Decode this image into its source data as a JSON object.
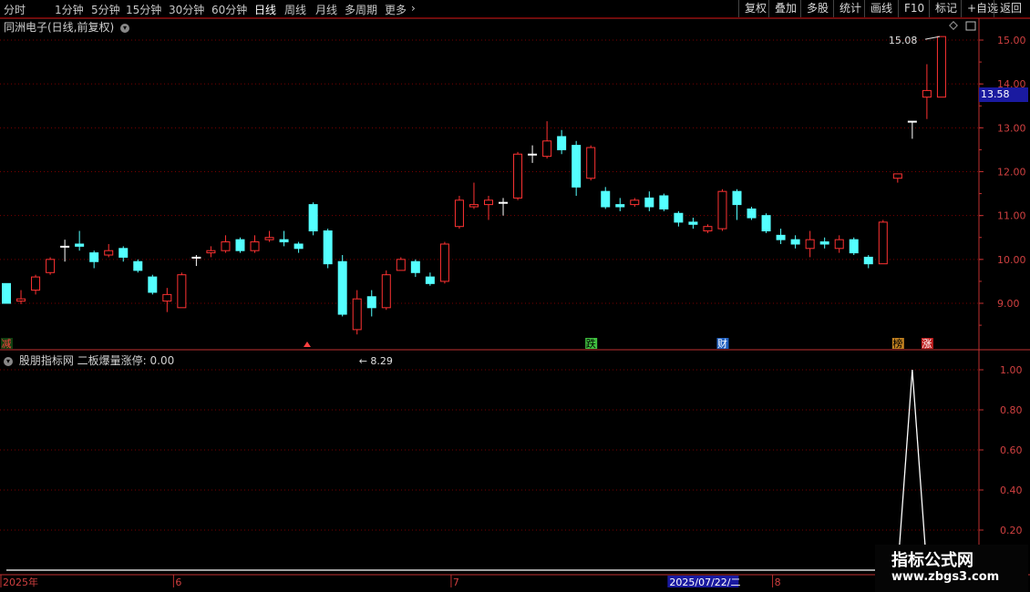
{
  "toolbar": {
    "periods": [
      "分时",
      "1分钟",
      "5分钟",
      "15分钟",
      "30分钟",
      "60分钟",
      "日线",
      "周线",
      "月线",
      "多周期",
      "更多"
    ],
    "active_period": "日线",
    "right_buttons": [
      "复权",
      "叠加",
      "多股",
      "统计",
      "画线",
      "F10",
      "标记",
      "+自选",
      "返回"
    ]
  },
  "upper": {
    "title": "同洲电子(日线,前复权)",
    "price_tag": "13.58",
    "high_label": "15.08",
    "low_label": "8.29",
    "markers": [
      {
        "text": "减",
        "color": "#ff4040",
        "bg": "#104010",
        "idx": 0
      },
      {
        "text": "跌",
        "color": "#000000",
        "bg": "#40c040",
        "idx": 40
      },
      {
        "text": "财",
        "color": "#ffffff",
        "bg": "#2060c0",
        "idx": 49
      },
      {
        "text": "榜",
        "color": "#000000",
        "bg": "#c08020",
        "idx": 61
      },
      {
        "text": "涨",
        "color": "#ffffff",
        "bg": "#c02020",
        "idx": 63
      }
    ]
  },
  "lower": {
    "title": "股朋指标网 二板爆量涨停: 0.00"
  },
  "logo": {
    "line1": "指标公式网",
    "line2": "www.zbgs3.com"
  },
  "xaxis": {
    "labels": [
      {
        "text": "2025年",
        "idx": 0
      },
      {
        "text": "6",
        "idx": 12
      },
      {
        "text": "7",
        "idx": 31
      },
      {
        "text": "8",
        "idx": 53
      }
    ],
    "cursor_date": "2025/07/22/二",
    "cursor_idx": 46
  },
  "chart_data": {
    "type": "candlestick",
    "price_axis": {
      "ticks": [
        9.0,
        10.0,
        11.0,
        12.0,
        13.0,
        14.0,
        15.0
      ],
      "ylim": [
        8.0,
        15.5
      ]
    },
    "indicator_axis": {
      "ticks": [
        0.2,
        0.4,
        0.6,
        0.8,
        1.0
      ],
      "ylim": [
        0,
        1.1
      ]
    },
    "candles": [
      [
        9.45,
        9.0,
        9.45,
        9.0
      ],
      [
        9.05,
        9.1,
        9.3,
        8.98
      ],
      [
        9.3,
        9.6,
        9.65,
        9.2
      ],
      [
        9.7,
        10.0,
        10.05,
        9.65
      ],
      [
        10.3,
        10.3,
        10.45,
        9.95
      ],
      [
        10.35,
        10.3,
        10.65,
        10.2
      ],
      [
        10.15,
        9.95,
        10.2,
        9.8
      ],
      [
        10.1,
        10.2,
        10.35,
        10.05
      ],
      [
        10.25,
        10.05,
        10.3,
        9.95
      ],
      [
        9.95,
        9.75,
        10.0,
        9.7
      ],
      [
        9.6,
        9.25,
        9.65,
        9.2
      ],
      [
        9.05,
        9.2,
        9.35,
        8.8
      ],
      [
        8.9,
        9.65,
        9.7,
        8.9
      ],
      [
        10.05,
        10.05,
        10.1,
        9.85
      ],
      [
        10.15,
        10.2,
        10.3,
        10.05
      ],
      [
        10.2,
        10.4,
        10.55,
        10.15
      ],
      [
        10.45,
        10.2,
        10.5,
        10.15
      ],
      [
        10.2,
        10.4,
        10.55,
        10.15
      ],
      [
        10.45,
        10.5,
        10.65,
        10.4
      ],
      [
        10.45,
        10.4,
        10.65,
        10.3
      ],
      [
        10.35,
        10.25,
        10.4,
        10.15
      ],
      [
        11.25,
        10.65,
        11.3,
        10.55
      ],
      [
        10.65,
        9.9,
        10.7,
        9.8
      ],
      [
        9.95,
        8.75,
        10.1,
        8.7
      ],
      [
        8.4,
        9.1,
        9.3,
        8.29
      ],
      [
        9.15,
        8.9,
        9.3,
        8.7
      ],
      [
        8.9,
        9.65,
        9.75,
        8.85
      ],
      [
        9.75,
        10.0,
        10.05,
        9.75
      ],
      [
        9.95,
        9.7,
        10.0,
        9.6
      ],
      [
        9.6,
        9.45,
        9.7,
        9.4
      ],
      [
        9.5,
        10.35,
        10.4,
        9.45
      ],
      [
        10.75,
        11.35,
        11.45,
        10.7
      ],
      [
        11.2,
        11.25,
        11.75,
        11.15
      ],
      [
        11.25,
        11.35,
        11.45,
        10.9
      ],
      [
        11.3,
        11.3,
        11.4,
        11.0
      ],
      [
        11.4,
        12.4,
        12.45,
        11.35
      ],
      [
        12.4,
        12.4,
        12.6,
        12.2
      ],
      [
        12.35,
        12.7,
        13.15,
        12.3
      ],
      [
        12.8,
        12.5,
        12.95,
        12.4
      ],
      [
        12.6,
        11.65,
        12.7,
        11.45
      ],
      [
        11.85,
        12.55,
        12.6,
        11.8
      ],
      [
        11.55,
        11.2,
        11.65,
        11.15
      ],
      [
        11.25,
        11.2,
        11.4,
        11.1
      ],
      [
        11.25,
        11.35,
        11.4,
        11.2
      ],
      [
        11.4,
        11.2,
        11.55,
        11.1
      ],
      [
        11.45,
        11.15,
        11.5,
        11.1
      ],
      [
        11.05,
        10.85,
        11.1,
        10.75
      ],
      [
        10.85,
        10.8,
        10.95,
        10.7
      ],
      [
        10.65,
        10.75,
        10.8,
        10.6
      ],
      [
        10.7,
        11.55,
        11.6,
        10.65
      ],
      [
        11.55,
        11.25,
        11.6,
        10.9
      ],
      [
        11.15,
        10.95,
        11.2,
        10.9
      ],
      [
        11.0,
        10.65,
        11.05,
        10.6
      ],
      [
        10.55,
        10.45,
        10.7,
        10.35
      ],
      [
        10.45,
        10.35,
        10.55,
        10.25
      ],
      [
        10.25,
        10.45,
        10.65,
        10.05
      ],
      [
        10.4,
        10.35,
        10.5,
        10.25
      ],
      [
        10.25,
        10.45,
        10.55,
        10.15
      ],
      [
        10.45,
        10.15,
        10.5,
        10.1
      ],
      [
        10.05,
        9.9,
        10.1,
        9.8
      ],
      [
        9.9,
        10.85,
        10.9,
        9.9
      ],
      [
        11.85,
        11.95,
        11.95,
        11.75
      ],
      [
        13.15,
        13.15,
        13.15,
        12.75
      ],
      [
        13.7,
        13.85,
        14.45,
        13.2
      ],
      [
        13.7,
        15.08,
        15.08,
        13.7
      ]
    ],
    "indicator_values": [
      0,
      0,
      0,
      0,
      0,
      0,
      0,
      0,
      0,
      0,
      0,
      0,
      0,
      0,
      0,
      0,
      0,
      0,
      0,
      0,
      0,
      0,
      0,
      0,
      0,
      0,
      0,
      0,
      0,
      0,
      0,
      0,
      0,
      0,
      0,
      0,
      0,
      0,
      0,
      0,
      0,
      0,
      0,
      0,
      0,
      0,
      0,
      0,
      0,
      0,
      0,
      0,
      0,
      0,
      0,
      0,
      0,
      0,
      0,
      0,
      0,
      0,
      1,
      0,
      0
    ]
  },
  "colors": {
    "up": "#ff3232",
    "down": "#54ffff",
    "doji": "#ffffff",
    "grid": "#7a0000",
    "axis": "#c03030"
  }
}
